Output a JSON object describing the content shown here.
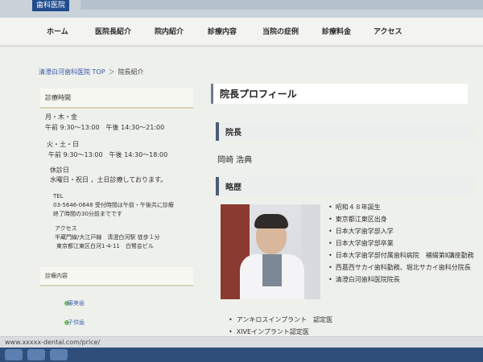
{
  "header": {
    "logo_text": "歯科医院"
  },
  "nav": {
    "items": [
      "ホーム",
      "医院長紹介",
      "院内紹介",
      "診療内容",
      "当院の症例",
      "診療料金",
      "アクセス"
    ]
  },
  "breadcrumb": {
    "home": "清澄白河歯科医院 TOP",
    "separator": "＞",
    "current": "院長紹介"
  },
  "sidebar": {
    "header": "診療時間",
    "lines": [
      "月・木・金",
      "午前 9:30～13:00　午後 14:30～21:00",
      "火・土・日",
      "午前 9:30～13:00　午後 14:30～18:00",
      "休診日",
      "水曜日・祝日 ，土日診療しております。",
      "TEL",
      "03-5646-0648 受付時間は午前・午後共に診療",
      "終了時間の30分前までです",
      "アクセス",
      "半蔵門線/大江戸線　清澄白河駅 徒歩１分",
      "東京都江東区白河1-4-11　白鷺会ビル"
    ],
    "header2": "診療内容",
    "links": [
      "審美歯",
      "子供歯"
    ]
  },
  "main": {
    "title": "院長プロフィール",
    "section1": "院長",
    "name": "岡崎 浩典",
    "section2": "略歴",
    "career": [
      "昭和４８年誕生",
      "東京都江東区出身",
      "日本大学歯学部入学",
      "日本大学歯学部卒業",
      "日本大学歯学部付属歯科病院　補綴第Ⅱ講座勤務",
      "西葛西サカイ歯科勤務、堀北サカイ歯科分院長",
      "清澄白河歯科医院院長"
    ],
    "certs": [
      "アンキロスインプラント　認定医",
      "XIVEインプラント認定医"
    ]
  },
  "status": {
    "url": "www.xxxxx-dental.com/price/"
  }
}
